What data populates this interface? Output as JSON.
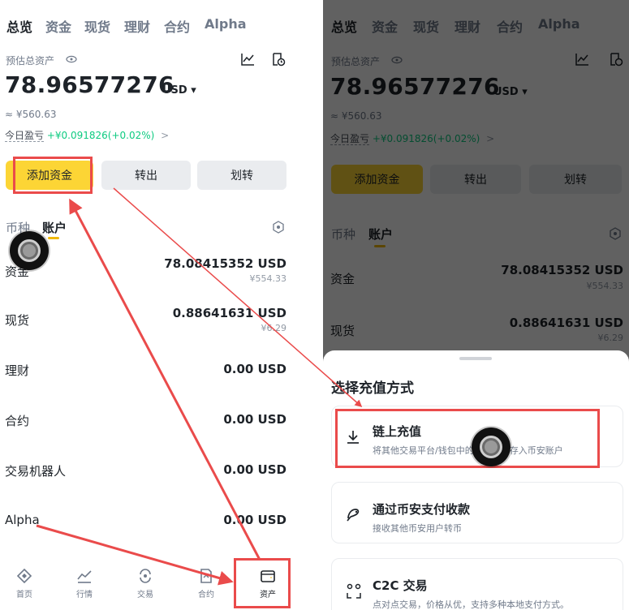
{
  "nav": {
    "tabs": [
      "总览",
      "资金",
      "现货",
      "理财",
      "合约",
      "Alpha"
    ]
  },
  "summary": {
    "title": "预估总资产",
    "balance": "78.96577276",
    "currency": "USD",
    "fiat": "≈ ¥560.63",
    "pnl_label": "今日盈亏",
    "pnl_value": "+¥0.091826(+0.02%)",
    "pnl_arrow": ">"
  },
  "actions": {
    "add_funds": "添加资金",
    "withdraw": "转出",
    "transfer": "划转"
  },
  "segments": {
    "coin": "币种",
    "account": "账户"
  },
  "accounts": [
    {
      "label": "资金",
      "value": "78.08415352 USD",
      "fiat": "¥554.33"
    },
    {
      "label": "现货",
      "value": "0.88641631 USD",
      "fiat": "¥6.29"
    },
    {
      "label": "理财",
      "value": "0.00 USD",
      "fiat": ""
    },
    {
      "label": "合约",
      "value": "0.00 USD",
      "fiat": ""
    },
    {
      "label": "交易机器人",
      "value": "0.00 USD",
      "fiat": ""
    },
    {
      "label": "Alpha",
      "value": "0.00 USD",
      "fiat": ""
    }
  ],
  "bottom_nav": [
    {
      "label": "首页",
      "icon": "home-icon"
    },
    {
      "label": "行情",
      "icon": "market-chart-icon"
    },
    {
      "label": "交易",
      "icon": "trade-icon"
    },
    {
      "label": "合约",
      "icon": "futures-icon"
    },
    {
      "label": "资产",
      "icon": "wallet-icon"
    }
  ],
  "sheet": {
    "title": "选择充值方式",
    "options": [
      {
        "title": "链上充值",
        "desc": "将其他交易平台/钱包中的加密货币存入币安账户",
        "icon": "download-icon"
      },
      {
        "title": "通过币安支付收款",
        "desc": "接收其他币安用户转币",
        "icon": "pay-icon"
      },
      {
        "title": "C2C 交易",
        "desc": "点对点交易，价格从优，支持多种本地支付方式。",
        "icon": "c2c-icon"
      }
    ]
  },
  "colors": {
    "accent": "#fcd535",
    "positive": "#0ecb81",
    "annotation": "#ea4b4b"
  }
}
